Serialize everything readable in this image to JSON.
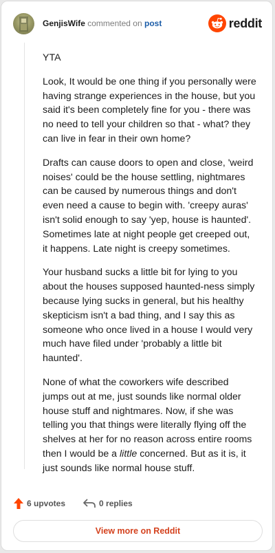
{
  "header": {
    "username": "GenjisWife",
    "action_text": "commented on",
    "post_link": "post",
    "brand": "reddit"
  },
  "comment": {
    "paragraphs": [
      "YTA",
      "Look, It would be one thing if you personally were having strange experiences in the house, but you said it's been completely fine for you - there was no need to tell your children so that - what? they can live in fear in their own home?",
      "Drafts can cause doors to open and close, 'weird noises' could be the house settling, nightmares can be caused by numerous things and don't even need a cause to begin with. 'creepy auras' isn't solid enough to say 'yep, house is haunted'. Sometimes late at night people get creeped out, it happens. Late night is creepy sometimes.",
      "Your husband sucks a little bit for lying to you about the houses supposed haunted-ness simply because lying sucks in general, but his healthy skepticism isn't a bad thing, and I say this as someone who once lived in a house I would very much have filed under 'probably a little bit haunted'."
    ],
    "last_paragraph": {
      "before": "None of what the coworkers wife described jumps out at me, just sounds like normal older house stuff and nightmares. Now, if she was telling you that things were literally flying off the shelves at her for no reason across entire rooms then I would be a ",
      "emphasis": "little",
      "after": " concerned. But as it is, it just sounds like normal house stuff."
    }
  },
  "actions": {
    "upvotes": "6 upvotes",
    "replies": "0 replies"
  },
  "footer": {
    "view_more": "View more on Reddit"
  },
  "colors": {
    "brand_orange": "#ff4500",
    "link_blue": "#1c5da8",
    "view_more_text": "#d4421e"
  },
  "icons": [
    "avatar",
    "reddit-logo-icon",
    "upvote-arrow-icon",
    "reply-icon"
  ]
}
